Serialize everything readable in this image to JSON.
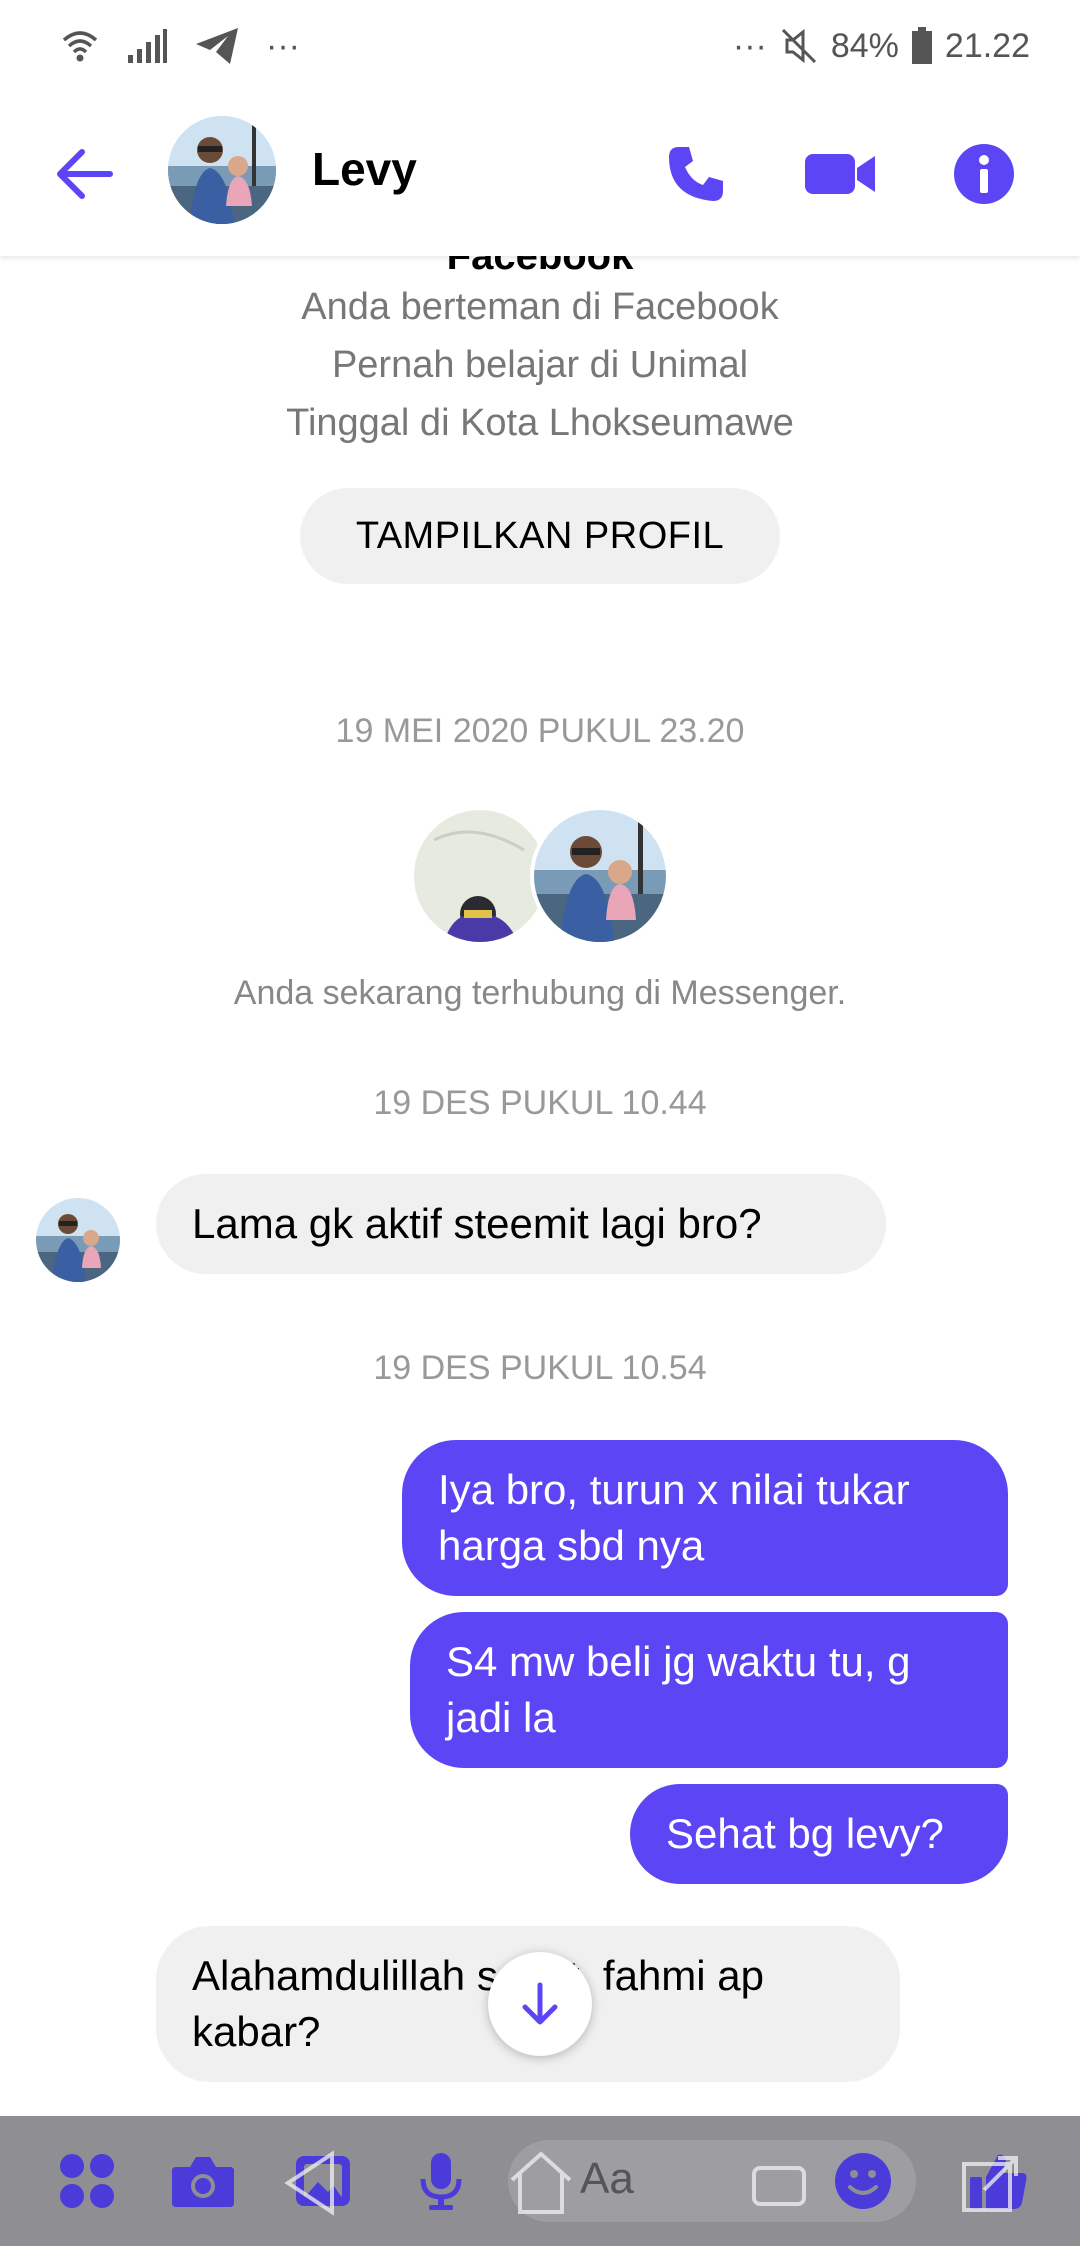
{
  "status_bar": {
    "left_dots": "···",
    "right_dots": "···",
    "battery_percent": "84%",
    "time": "21.22"
  },
  "header": {
    "contact_name": "Levy"
  },
  "profile_info": {
    "cut_line": "Facebook",
    "lines": [
      "Anda berteman di Facebook",
      "Pernah belajar di Unimal",
      "Tinggal di Kota Lhokseumawe"
    ],
    "button_label": "TAMPILKAN PROFIL"
  },
  "timeline": {
    "ts1": "19 MEI 2020 PUKUL 23.20",
    "connected_text": "Anda sekarang terhubung di Messenger.",
    "ts2": "19 DES PUKUL 10.44",
    "ts3": "19 DES PUKUL 10.54"
  },
  "messages": [
    {
      "from": "Levy",
      "text": "Lama gk aktif steemit lagi bro?"
    },
    {
      "from": "me",
      "text": "Iya bro, turun x nilai tukar harga sbd nya"
    },
    {
      "from": "me",
      "text": "S4 mw beli jg waktu tu, g jadi la"
    },
    {
      "from": "me",
      "text": "Sehat bg levy?"
    },
    {
      "from": "Levy",
      "text": "Alahamdulillah sehat, fahmi ap kabar?"
    }
  ],
  "composer": {
    "placeholder": "Aa"
  },
  "colors": {
    "accent": "#5b45f5",
    "incoming_bubble": "#f0f0f0",
    "composer_bg": "#8e8e93"
  }
}
